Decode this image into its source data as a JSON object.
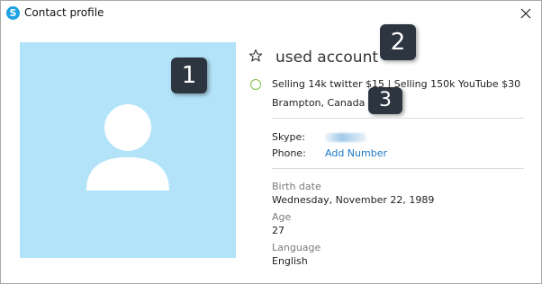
{
  "window": {
    "title": "Contact profile",
    "app_icon_letter": "S",
    "close_icon": "close-icon"
  },
  "profile": {
    "avatar_icon": "person-silhouette-icon",
    "star_icon": "star-outline-icon",
    "display_name": "used account",
    "status_icon": "status-ring-icon",
    "mood": "Selling 14k twitter $15 | Selling 150k YouTube $30",
    "location": "Brampton, Canada"
  },
  "contact": {
    "skype_label": "Skype:",
    "phone_label": "Phone:",
    "add_number": "Add Number"
  },
  "details": {
    "birth_date_label": "Birth date",
    "birth_date_value": "Wednesday, November 22, 1989",
    "age_label": "Age",
    "age_value": "27",
    "language_label": "Language",
    "language_value": "English"
  },
  "callouts": [
    "1",
    "2",
    "3"
  ],
  "colors": {
    "skype_blue": "#1da1e2",
    "avatar_bg": "#b3e3f9",
    "link": "#1a77c6",
    "status_ring": "#7dc243",
    "callout_bg": "#2d3640"
  }
}
